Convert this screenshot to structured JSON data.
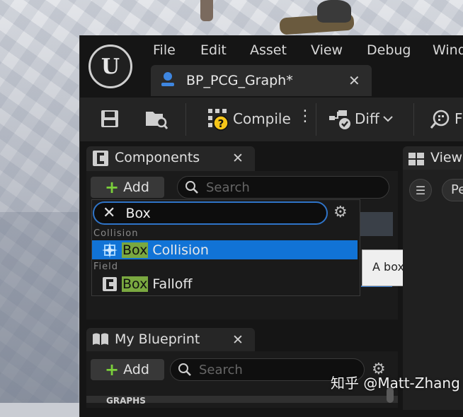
{
  "window": {
    "document_tab": "BP_PCG_Graph*"
  },
  "menu": [
    "File",
    "Edit",
    "Asset",
    "View",
    "Debug",
    "Wind"
  ],
  "toolbar": {
    "compile_label": "Compile",
    "diff_label": "Diff",
    "extra_label": "F"
  },
  "components_panel": {
    "title": "Components",
    "add_label": "Add",
    "search_placeholder": "Search",
    "filter_value": "Box",
    "categories": [
      {
        "label": "Collision",
        "items": [
          {
            "match": "Box",
            "rest": " Collision",
            "selected": true
          }
        ]
      },
      {
        "label": "Field",
        "items": [
          {
            "match": "Box",
            "rest": " Falloff",
            "selected": false
          }
        ]
      }
    ],
    "tooltip": "A box generally u"
  },
  "viewport_panel": {
    "title": "Viewp",
    "pill_label": "Pe"
  },
  "my_blueprint_panel": {
    "title": "My Blueprint",
    "add_label": "Add",
    "search_placeholder": "Search",
    "section_label": "GRAPHS"
  },
  "watermark": "知乎 @Matt-Zhang",
  "colors": {
    "accent": "#1173d6",
    "match_highlight": "#7aa840",
    "add_plus": "#7bcf3b"
  }
}
